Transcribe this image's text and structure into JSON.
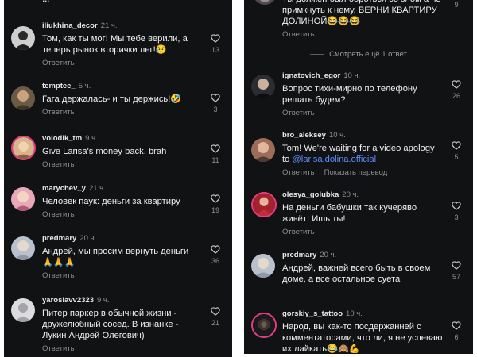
{
  "colors": {
    "background": "#111214",
    "text": "#f0f0f2",
    "muted": "#8e8f94",
    "link": "#5c8dff"
  },
  "left": {
    "partial_username": "…",
    "comments": [
      {
        "user": "iliukhina_decor",
        "time": "21 ч.",
        "text": "Том, как ты мог! Мы тебе верили, а теперь рынок вторички лег!😥",
        "reply": "Ответить",
        "likes": "13"
      },
      {
        "user": "temptee_",
        "time": "5 ч.",
        "text": "Гага держалась- и ты держись!🤣",
        "reply": "Ответить",
        "likes": "3"
      },
      {
        "user": "volodik_tm",
        "time": "9 ч.",
        "text": "Give Larisa's money back, brah",
        "reply": "Ответить",
        "likes": "11"
      },
      {
        "user": "marychev_y",
        "time": "21 ч.",
        "text": "Человек паук: деньги за квартиру",
        "reply": "Ответить",
        "likes": "19"
      },
      {
        "user": "predmary",
        "time": "20 ч.",
        "text": "Андрей, мы просим вернуть деньги\n🙏🙏🙏",
        "reply": "Ответить",
        "likes": "36"
      },
      {
        "user": "yaroslavv2323",
        "time": "9 ч.",
        "text": "Питер паркер в обычной жизни - дружелюбный сосед. В изнанке - Лукин Андрей Олегович)",
        "reply": "Ответить",
        "likes": "21"
      }
    ]
  },
  "right": {
    "top_comment": {
      "text": "Ты должен был бороться со злом а не примкнуть к нему, ВЕРНИ КВАРТИРУ ДОЛИНОЙ😂😂😂",
      "reply": "Ответить",
      "likes": "9"
    },
    "view_more": "Смотреть ещё 1 ответ",
    "comments": [
      {
        "user": "ignatovich_egor",
        "time": "10 ч.",
        "text": "Вопрос тихи-мирно по телефону решать будем?",
        "reply": "Ответить",
        "likes": "26"
      },
      {
        "user": "bro_aleksey",
        "time": "10 ч.",
        "text_before": "Tom! We're waiting for a video apology to ",
        "mention": "@larisa.dolina.official",
        "reply": "Ответить",
        "translate": "Показать перевод",
        "likes": "5"
      },
      {
        "user": "olesya_golubka",
        "time": "20 ч.",
        "text": "На деньги бабушки так кучеряво живёт! Ишь ты!",
        "reply": "Ответить",
        "likes": "3"
      },
      {
        "user": "predmary",
        "time": "20 ч.",
        "text": "Андрей, важней всего быть в своем доме, а все остальное суета",
        "reply": "Ответить",
        "likes": "57"
      },
      {
        "user": "gorskiy_s_tattoo",
        "time": "10 ч.",
        "text": "Народ, вы как-то посдержанней с комментаторами, что ли, я не успеваю их лайкать😂🙈💪",
        "reply": "Ответить",
        "likes": "6"
      }
    ]
  }
}
